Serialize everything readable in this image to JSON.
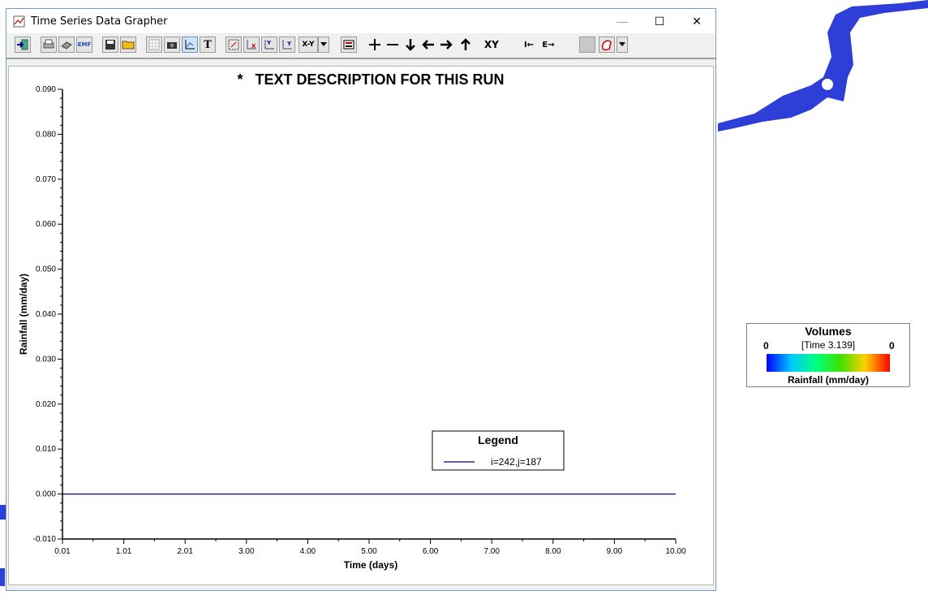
{
  "window": {
    "title": "Time Series Data Grapher",
    "controls": {
      "minimize": "—",
      "maximize": "☐",
      "close": "✕"
    }
  },
  "toolbar": {
    "buttons": [
      {
        "name": "exit-button",
        "icon": "exit-icon"
      },
      {
        "name": "print-setup-button",
        "icon": "printer-setup-icon"
      },
      {
        "name": "print-button",
        "icon": "printer-icon"
      },
      {
        "name": "export-emf-button",
        "icon": "emf-export-icon",
        "label": "EMF"
      },
      {
        "name": "save-button",
        "icon": "floppy-disk-icon"
      },
      {
        "name": "open-button",
        "icon": "folder-icon"
      },
      {
        "name": "grid-button",
        "icon": "grid-icon"
      },
      {
        "name": "camera-button",
        "icon": "camera-icon"
      },
      {
        "name": "axis-button",
        "icon": "axis-icon"
      },
      {
        "name": "text-button",
        "icon": "text-icon",
        "label": "T"
      },
      {
        "name": "zoom-box-button",
        "icon": "zoom-box-icon"
      },
      {
        "name": "x-axis-button",
        "icon": "x-axis-icon"
      },
      {
        "name": "y-axis-button",
        "icon": "y-axis-icon"
      },
      {
        "name": "y-scale-button",
        "icon": "y-scale-icon"
      },
      {
        "name": "xy-dropdown-button",
        "icon": "xy-icon",
        "label": "X-Y"
      },
      {
        "name": "legend-button",
        "icon": "legend-icon"
      },
      {
        "name": "zoom-in-button",
        "icon": "plus-icon"
      },
      {
        "name": "zoom-out-button",
        "icon": "minus-icon"
      },
      {
        "name": "pan-down-button",
        "icon": "arrow-down-icon"
      },
      {
        "name": "pan-left-button",
        "icon": "arrow-left-icon"
      },
      {
        "name": "pan-right-button",
        "icon": "arrow-right-icon"
      },
      {
        "name": "pan-up-button",
        "icon": "arrow-up-icon"
      },
      {
        "name": "xy-swap-button",
        "icon": "xy-swap-icon",
        "label": "XY"
      },
      {
        "name": "first-button",
        "icon": "first-icon",
        "label": "I←"
      },
      {
        "name": "last-button",
        "icon": "last-icon",
        "label": "E→"
      },
      {
        "name": "blank-button",
        "icon": "blank-icon"
      },
      {
        "name": "color-button",
        "icon": "palette-icon"
      }
    ]
  },
  "chart_data": {
    "type": "line",
    "title": "*   TEXT DESCRIPTION FOR THIS RUN",
    "xlabel": "Time (days)",
    "ylabel": "Rainfall (mm/day)",
    "xlim": [
      0.01,
      10.0
    ],
    "ylim": [
      -0.01,
      0.09
    ],
    "x_ticks": [
      "0.01",
      "1.01",
      "2.01",
      "3.00",
      "4.00",
      "5.00",
      "6.00",
      "7.00",
      "8.00",
      "9.00",
      "10.00"
    ],
    "y_ticks": [
      "-0.010",
      "0.000",
      "0.010",
      "0.020",
      "0.030",
      "0.040",
      "0.050",
      "0.060",
      "0.070",
      "0.080",
      "0.090"
    ],
    "grid": false,
    "legend": {
      "title": "Legend",
      "placement": "bottom-right"
    },
    "series": [
      {
        "name": "i=242,j=187",
        "color": "#000080",
        "x": [
          0.01,
          10.0
        ],
        "y": [
          0.0,
          0.0
        ]
      }
    ]
  },
  "colorbar": {
    "title": "Volumes",
    "time_label": "[Time 3.139]",
    "min": "0",
    "max": "0",
    "label": "Rainfall (mm/day)"
  },
  "map": {
    "fill_color": "#2e3fd8"
  }
}
